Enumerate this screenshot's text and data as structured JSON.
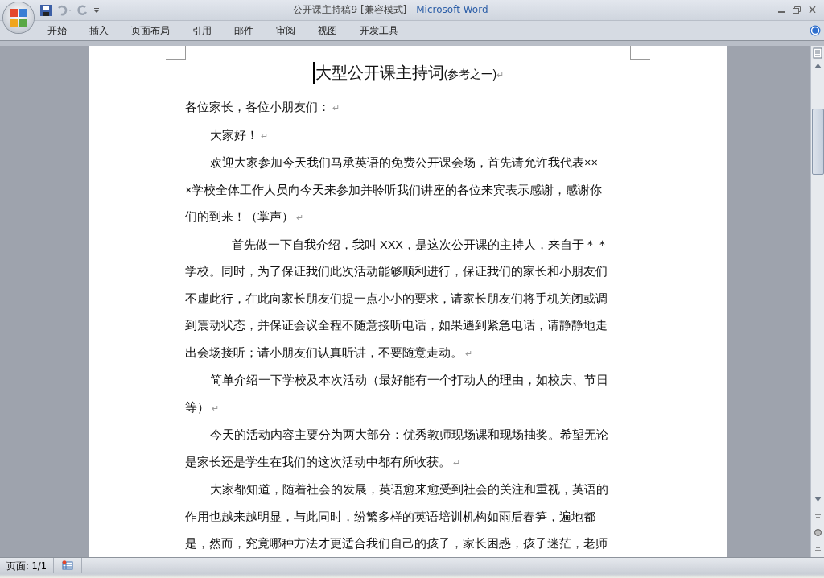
{
  "window": {
    "document_title": "公开课主持稿9 [兼容模式]",
    "separator": " - ",
    "app_name": "Microsoft Word"
  },
  "ribbon": {
    "tabs": [
      {
        "label": "开始",
        "selected": false
      },
      {
        "label": "插入",
        "selected": false
      },
      {
        "label": "页面布局",
        "selected": false
      },
      {
        "label": "引用",
        "selected": false
      },
      {
        "label": "邮件",
        "selected": false
      },
      {
        "label": "审阅",
        "selected": false
      },
      {
        "label": "视图",
        "selected": false
      },
      {
        "label": "开发工具",
        "selected": false
      }
    ]
  },
  "document": {
    "title": "大型公开课主持词",
    "subtitle": "(参考之一)",
    "end_mark": "↵",
    "paragraphs": [
      {
        "kind": "flush",
        "lines": [
          "各位家长，各位小朋友们："
        ],
        "end_mark": "↵"
      },
      {
        "kind": "indent",
        "lines": [
          "大家好！"
        ],
        "end_mark": "↵"
      },
      {
        "kind": "indent",
        "lines": [
          "欢迎大家参加今天我们马承英语的免费公开课会场，首先请允许我代表××",
          "×学校全体工作人员向今天来参加并聆听我们讲座的各位来宾表示感谢，感谢你",
          "们的到来！（掌声）"
        ],
        "end_mark": "↵"
      },
      {
        "kind": "wide_indent",
        "lines": [
          "首先做一下自我介绍，我叫 XXX，是这次公开课的主持人，来自于＊＊",
          "学校。同时，为了保证我们此次活动能够顺利进行，保证我们的家长和小朋友们",
          "不虚此行，在此向家长朋友们提一点小小的要求，请家长朋友们将手机关闭或调",
          "到震动状态，并保证会议全程不随意接听电话，如果遇到紧急电话，请静静地走",
          "出会场接听；请小朋友们认真听讲，不要随意走动。"
        ],
        "end_mark": "↵"
      },
      {
        "kind": "indent",
        "lines": [
          "简单介绍一下学校及本次活动（最好能有一个打动人的理由，如校庆、节日",
          "等）"
        ],
        "end_mark": "↵"
      },
      {
        "kind": "indent",
        "lines": [
          "今天的活动内容主要分为两大部分：优秀教师现场课和现场抽奖。希望无论",
          "是家长还是学生在我们的这次活动中都有所收获。"
        ],
        "end_mark": "↵"
      },
      {
        "kind": "indent",
        "lines": [
          "大家都知道，随着社会的发展，英语愈来愈受到社会的关注和重视，英语的",
          "作用也越来越明显，与此同时，纷繁多样的英语培训机构如雨后春笋，遍地都",
          "是，然而，究竟哪种方法才更适合我们自己的孩子，家长困惑，孩子迷茫，老师"
        ]
      }
    ]
  },
  "status_bar": {
    "page": "页面: 1/1"
  }
}
